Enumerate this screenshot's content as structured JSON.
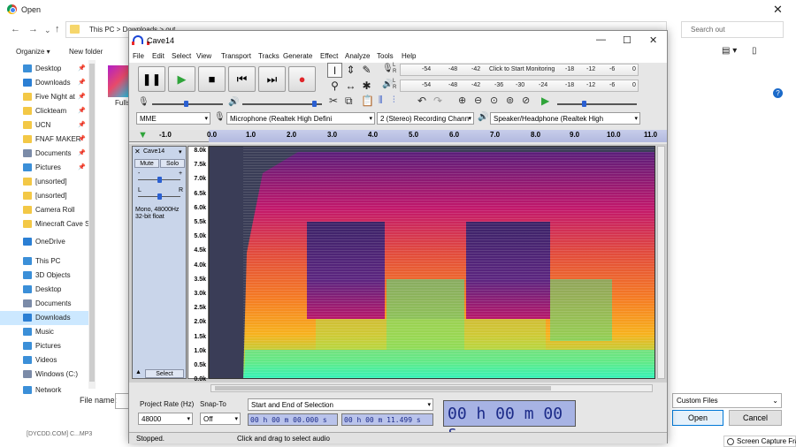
{
  "dialog": {
    "title": "Open",
    "breadcrumbs": "This PC  >  Downloads  >  out",
    "search_placeholder": "Search out",
    "organize": "Organize ▾",
    "new_folder": "New folder",
    "nav_items": [
      {
        "label": "Desktop",
        "pinned": true,
        "color": "#3b8fd8"
      },
      {
        "label": "Downloads",
        "pinned": true,
        "color": "#2b7fd4"
      },
      {
        "label": "Five Night at",
        "pinned": true,
        "color": "#f3c846"
      },
      {
        "label": "Clickteam",
        "pinned": true,
        "color": "#f3c846"
      },
      {
        "label": "UCN",
        "pinned": true,
        "color": "#f3c846"
      },
      {
        "label": "FNAF MAKER",
        "pinned": true,
        "color": "#f3c846"
      },
      {
        "label": "Documents",
        "pinned": true,
        "color": "#7b8ba8"
      },
      {
        "label": "Pictures",
        "pinned": true,
        "color": "#3b8fd8"
      },
      {
        "label": "[unsorted]",
        "pinned": false,
        "color": "#f3c846"
      },
      {
        "label": "[unsorted]",
        "pinned": false,
        "color": "#f3c846"
      },
      {
        "label": "Camera Roll",
        "pinned": false,
        "color": "#f3c846"
      },
      {
        "label": "Minecraft Cave S",
        "pinned": false,
        "color": "#f3c846"
      },
      {
        "label": "",
        "pinned": false,
        "color": "#fff"
      },
      {
        "label": "OneDrive",
        "pinned": false,
        "color": "#2b7fd4"
      },
      {
        "label": "",
        "pinned": false,
        "color": "#fff"
      },
      {
        "label": "This PC",
        "pinned": false,
        "color": "#3b8fd8"
      },
      {
        "label": "3D Objects",
        "pinned": false,
        "color": "#3b8fd8"
      },
      {
        "label": "Desktop",
        "pinned": false,
        "color": "#3b8fd8"
      },
      {
        "label": "Documents",
        "pinned": false,
        "color": "#7b8ba8"
      },
      {
        "label": "Downloads",
        "pinned": false,
        "color": "#2b7fd4",
        "selected": true
      },
      {
        "label": "Music",
        "pinned": false,
        "color": "#3b8fd8"
      },
      {
        "label": "Pictures",
        "pinned": false,
        "color": "#3b8fd8"
      },
      {
        "label": "Videos",
        "pinned": false,
        "color": "#3b8fd8"
      },
      {
        "label": "Windows (C:)",
        "pinned": false,
        "color": "#7b8ba8"
      },
      {
        "label": "Network",
        "pinned": false,
        "color": "#3b8fd8"
      }
    ],
    "thumb_label": "Fulls",
    "file_name_label": "File name:",
    "file_type": "Custom Files",
    "open_label": "Open",
    "cancel_label": "Cancel",
    "taskbar_text": "[DYCDD.COM] C...MP3",
    "screen_capture": "Screen Capture Fra"
  },
  "audacity": {
    "title": "Cave14",
    "menu": [
      "File",
      "Edit",
      "Select",
      "View",
      "Transport",
      "Tracks",
      "Generate",
      "Effect",
      "Analyze",
      "Tools",
      "Help"
    ],
    "meter_record": {
      "start_text": "Click to Start Monitoring",
      "ticks": [
        "-54",
        "-48",
        "-42",
        "-18",
        "-12",
        "-6",
        "0"
      ]
    },
    "meter_play": {
      "ticks": [
        "-54",
        "-48",
        "-42",
        "-36",
        "-30",
        "-24",
        "-18",
        "-12",
        "-6",
        "0"
      ]
    },
    "host": "MME",
    "input_device": "Microphone (Realtek High Defini",
    "channels": "2 (Stereo) Recording Chann",
    "output_device": "Speaker/Headphone (Realtek High",
    "ruler": [
      "-1.0",
      "0.0",
      "1.0",
      "2.0",
      "3.0",
      "4.0",
      "5.0",
      "6.0",
      "7.0",
      "8.0",
      "9.0",
      "10.0",
      "11.0"
    ],
    "track": {
      "name": "Cave14",
      "mute": "Mute",
      "solo": "Solo",
      "gain_minus": "-",
      "gain_plus": "+",
      "pan_left": "L",
      "pan_right": "R",
      "info": "Mono, 48000Hz\n32-bit float",
      "select": "Select"
    },
    "freq_labels": [
      "8.0k",
      "7.5k",
      "7.0k",
      "6.5k",
      "6.0k",
      "5.5k",
      "5.0k",
      "4.5k",
      "4.0k",
      "3.5k",
      "3.0k",
      "2.5k",
      "2.0k",
      "1.5k",
      "1.0k",
      "0.5k",
      "0.0k"
    ],
    "project_rate_label": "Project Rate (Hz)",
    "project_rate": "48000",
    "snap_label": "Snap-To",
    "snap": "Off",
    "selection_mode": "Start and End of Selection",
    "sel_start": "00 h 00 m 00.000 s",
    "sel_end": "00 h 00 m 11.499 s",
    "big_time": "00 h 00 m 00 s",
    "status_left": "Stopped.",
    "status_right": "Click and drag to select audio"
  }
}
